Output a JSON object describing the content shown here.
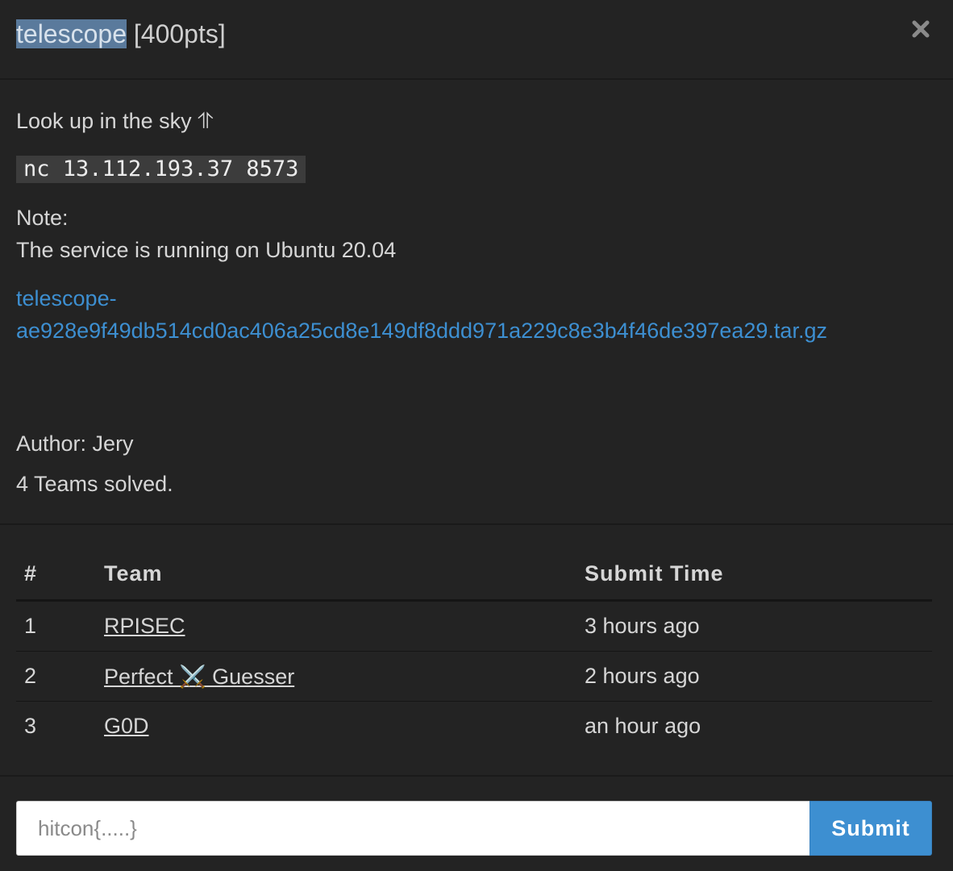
{
  "challenge": {
    "name": "telescope",
    "points": "[400pts]",
    "description": "Look up in the sky ⥣",
    "command": "nc 13.112.193.37 8573",
    "note_label": "Note:",
    "note_text": "The service is running on Ubuntu 20.04",
    "file_line1": "telescope-",
    "file_line2": "ae928e9f49db514cd0ac406a25cd8e149df8ddd971a229c8e3b4f46de397ea29.tar.gz",
    "author": "Author: Jery",
    "solved": "4 Teams solved."
  },
  "solves_table": {
    "headers": [
      "#",
      "Team",
      "Submit Time"
    ],
    "rows": [
      {
        "rank": "1",
        "team": "RPISEC",
        "time": "3 hours ago"
      },
      {
        "rank": "2",
        "team": "Perfect ⚔️ Guesser",
        "time": "2 hours ago"
      },
      {
        "rank": "3",
        "team": "G0D",
        "time": "an hour ago"
      }
    ]
  },
  "flag_form": {
    "placeholder": "hitcon{.....}",
    "submit_label": "Submit"
  },
  "icons": {
    "close": "close-icon"
  },
  "colors": {
    "background": "#232323",
    "link": "#3d8fd1",
    "submit_button": "#3d8fd1",
    "title_highlight": "#5a7a9c"
  }
}
